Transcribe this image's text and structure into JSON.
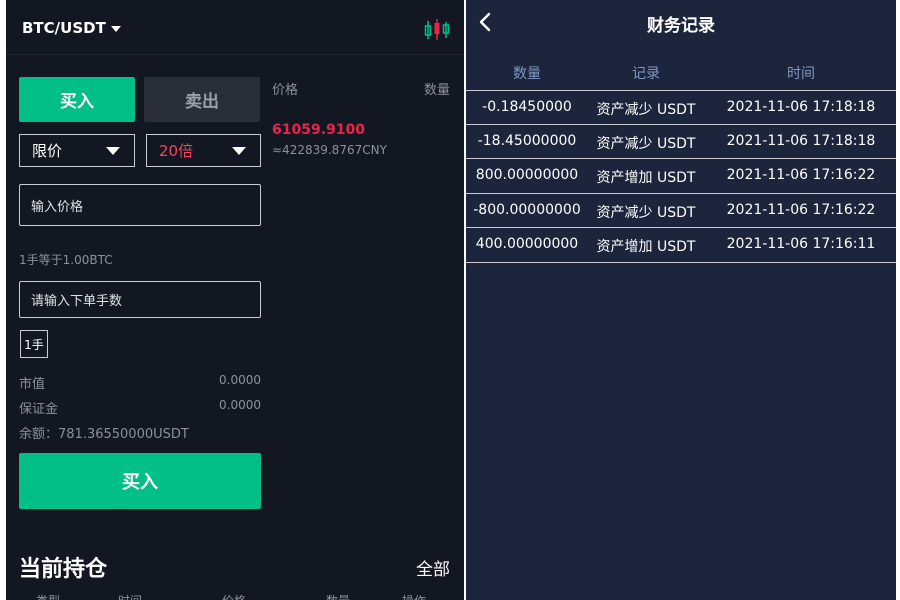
{
  "left": {
    "pair": "BTC/USDT",
    "tabs": {
      "buy": "买入",
      "sell": "卖出"
    },
    "order_type": "限价",
    "leverage": "20倍",
    "price_placeholder": "输入价格",
    "lot_note": "1手等于1.00BTC",
    "qty_placeholder": "请输入下单手数",
    "lot_button": "1手",
    "market_value": {
      "label": "市值",
      "value": "0.0000"
    },
    "margin": {
      "label": "保证金",
      "value": "0.0000"
    },
    "balance": "余额：781.36550000USDT",
    "buy_button": "买入",
    "positions": {
      "title": "当前持仓",
      "all": "全部",
      "columns": [
        "类型",
        "时间",
        "价格",
        "数量",
        "操作"
      ]
    },
    "orderbook": {
      "price_header": "价格",
      "qty_header": "数量",
      "last_price": "61059.9100",
      "cny_price": "≈422839.8767CNY"
    }
  },
  "right": {
    "title": "财务记录",
    "headers": [
      "数量",
      "记录",
      "时间"
    ],
    "rows": [
      {
        "amount": "-0.18450000",
        "record": "资产减少 USDT",
        "time": "2021-11-06 17:18:18"
      },
      {
        "amount": "-18.45000000",
        "record": "资产减少 USDT",
        "time": "2021-11-06 17:18:18"
      },
      {
        "amount": "800.00000000",
        "record": "资产增加 USDT",
        "time": "2021-11-06 17:16:22"
      },
      {
        "amount": "-800.00000000",
        "record": "资产减少 USDT",
        "time": "2021-11-06 17:16:22"
      },
      {
        "amount": "400.00000000",
        "record": "资产增加 USDT",
        "time": "2021-11-06 17:16:11"
      }
    ]
  },
  "colors": {
    "buy_green": "#02bf87",
    "sell_red": "#e8264c",
    "left_bg": "#131722",
    "right_bg": "#1c253b"
  }
}
